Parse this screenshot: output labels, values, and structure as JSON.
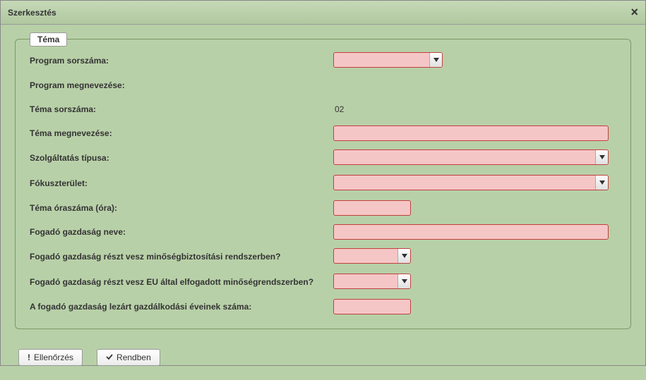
{
  "dialog": {
    "title": "Szerkesztés",
    "close_icon": "×"
  },
  "fieldset": {
    "legend": "Téma"
  },
  "form": {
    "program_sorszama": {
      "label": "Program sorszáma:",
      "value": ""
    },
    "program_megnevezese": {
      "label": "Program megnevezése:"
    },
    "tema_sorszama": {
      "label": "Téma sorszáma:",
      "value": "02"
    },
    "tema_megnevezese": {
      "label": "Téma megnevezése:",
      "value": ""
    },
    "szolgaltatas_tipusa": {
      "label": "Szolgáltatás típusa:",
      "value": ""
    },
    "fokuszterulet": {
      "label": "Fókuszterület:",
      "value": ""
    },
    "tema_oraszama": {
      "label": "Téma óraszáma (óra):",
      "value": ""
    },
    "fogado_gazdasag_neve": {
      "label": "Fogadó gazdaság neve:",
      "value": ""
    },
    "fogado_minosegbiztositasi": {
      "label": "Fogadó gazdaság részt vesz minőségbiztosítási rendszerben?",
      "value": ""
    },
    "fogado_eu_minoseg": {
      "label": "Fogadó gazdaság részt vesz EU által elfogadott minőségrendszerben?",
      "value": ""
    },
    "lezart_evek": {
      "label": "A fogadó gazdaság lezárt gazdálkodási éveinek száma:",
      "value": ""
    }
  },
  "buttons": {
    "ellenorzes": "Ellenőrzés",
    "rendben": "Rendben"
  }
}
